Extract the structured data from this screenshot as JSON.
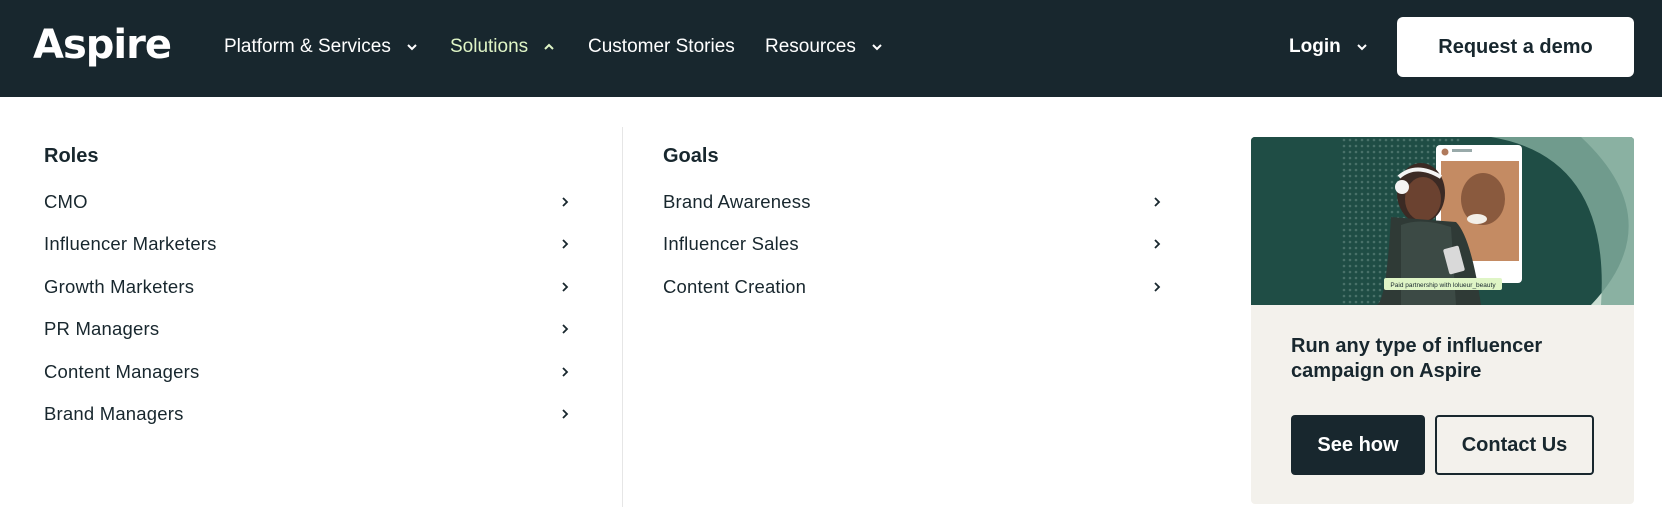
{
  "brand": {
    "name": "Aspire"
  },
  "nav": {
    "items": [
      {
        "label": "Platform & Services",
        "has_dropdown": true,
        "active": false
      },
      {
        "label": "Solutions",
        "has_dropdown": true,
        "active": true
      },
      {
        "label": "Customer Stories",
        "has_dropdown": false,
        "active": false
      },
      {
        "label": "Resources",
        "has_dropdown": true,
        "active": false
      }
    ],
    "login_label": "Login",
    "demo_label": "Request a demo"
  },
  "menu": {
    "roles": {
      "heading": "Roles",
      "items": [
        "CMO",
        "Influencer Marketers",
        "Growth Marketers",
        "PR Managers",
        "Content Managers",
        "Brand Managers"
      ]
    },
    "goals": {
      "heading": "Goals",
      "items": [
        "Brand Awareness",
        "Influencer Sales",
        "Content Creation"
      ]
    }
  },
  "promo": {
    "image_caption": "Paid partnership with lolueur_beauty",
    "title": "Run any type of influencer campaign on Aspire",
    "primary_label": "See how",
    "secondary_label": "Contact Us"
  },
  "colors": {
    "nav_bg": "#18272e",
    "active_nav": "#dff5c6",
    "promo_bg": "#f3f1ec",
    "image_bg": "#1f4d45"
  },
  "icons": {
    "nav_dropdown": "chevron-down-icon",
    "nav_open": "chevron-up-icon",
    "menu_row": "chevron-right-icon"
  }
}
